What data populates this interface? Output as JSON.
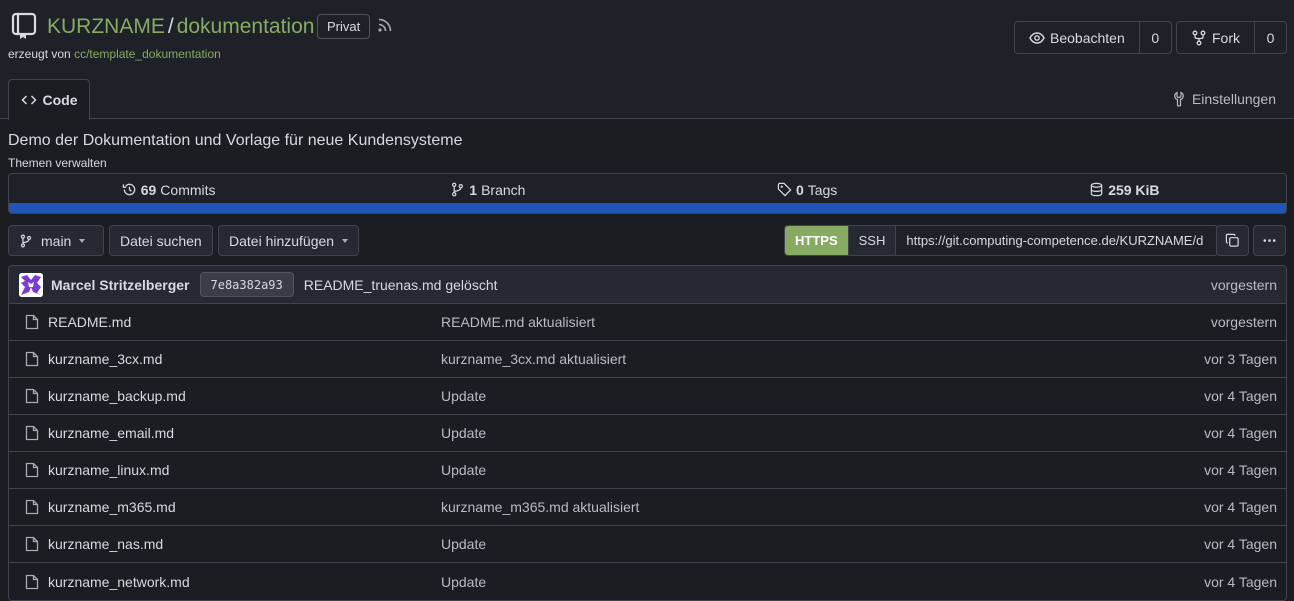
{
  "header": {
    "owner": "KURZNAME",
    "separator": "/",
    "repo": "dokumentation",
    "visibility": "Privat",
    "forked_prefix": "erzeugt von",
    "forked_from": "cc/template_dokumentation",
    "watch_label": "Beobachten",
    "watch_count": "0",
    "fork_label": "Fork",
    "fork_count": "0"
  },
  "tabs": {
    "code": "Code",
    "settings": "Einstellungen"
  },
  "description": "Demo der Dokumentation und Vorlage für neue Kundensysteme",
  "topics_link": "Themen verwalten",
  "stats": {
    "commits_count": "69",
    "commits_label": "Commits",
    "branches_count": "1",
    "branches_label": "Branch",
    "tags_count": "0",
    "tags_label": "Tags",
    "size": "259 KiB"
  },
  "toolbar": {
    "branch": "main",
    "find_file": "Datei suchen",
    "add_file": "Datei hinzufügen",
    "https": "HTTPS",
    "ssh": "SSH",
    "clone_url": "https://git.computing-competence.de/KURZNAME/d"
  },
  "latest_commit": {
    "author": "Marcel Stritzelberger",
    "sha": "7e8a382a93",
    "message": "README_truenas.md gelöscht",
    "time": "vorgestern"
  },
  "files": [
    {
      "name": "README.md",
      "message": "README.md aktualisiert",
      "time": "vorgestern"
    },
    {
      "name": "kurzname_3cx.md",
      "message": "kurzname_3cx.md aktualisiert",
      "time": "vor 3 Tagen"
    },
    {
      "name": "kurzname_backup.md",
      "message": "Update",
      "time": "vor 4 Tagen"
    },
    {
      "name": "kurzname_email.md",
      "message": "Update",
      "time": "vor 4 Tagen"
    },
    {
      "name": "kurzname_linux.md",
      "message": "Update",
      "time": "vor 4 Tagen"
    },
    {
      "name": "kurzname_m365.md",
      "message": "kurzname_m365.md aktualisiert",
      "time": "vor 4 Tagen"
    },
    {
      "name": "kurzname_nas.md",
      "message": "Update",
      "time": "vor 4 Tagen"
    },
    {
      "name": "kurzname_network.md",
      "message": "Update",
      "time": "vor 4 Tagen"
    }
  ],
  "colors": {
    "accent_green": "#87ab63",
    "language_bar": "#2156b8",
    "background": "#1b1d23"
  }
}
